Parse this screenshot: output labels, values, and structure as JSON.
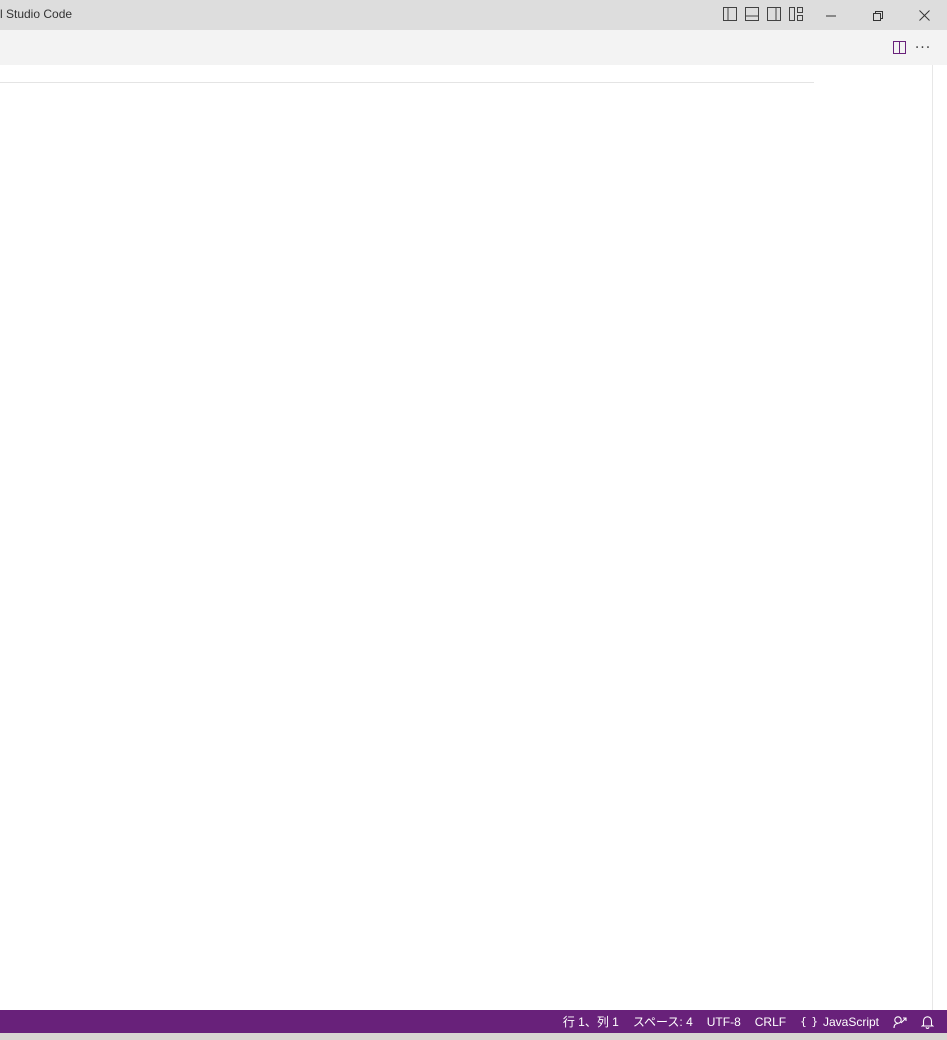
{
  "window": {
    "title": "l Studio Code"
  },
  "titlebar": {
    "layout_buttons": [
      {
        "icon": "toggle-primary-sidebar-icon"
      },
      {
        "icon": "toggle-panel-icon"
      },
      {
        "icon": "toggle-secondary-sidebar-icon"
      },
      {
        "icon": "customize-layout-icon"
      }
    ],
    "window_controls": [
      "minimize-icon",
      "restore-icon",
      "close-icon"
    ]
  },
  "editor_actions": {
    "split_icon": "split-editor-icon",
    "more_label": "···"
  },
  "statusbar": {
    "background": "#68217a",
    "position": "行 1、列 1",
    "indent": "スペース: 4",
    "encoding": "UTF-8",
    "eol": "CRLF",
    "language_braces": "{ }",
    "language": "JavaScript"
  }
}
